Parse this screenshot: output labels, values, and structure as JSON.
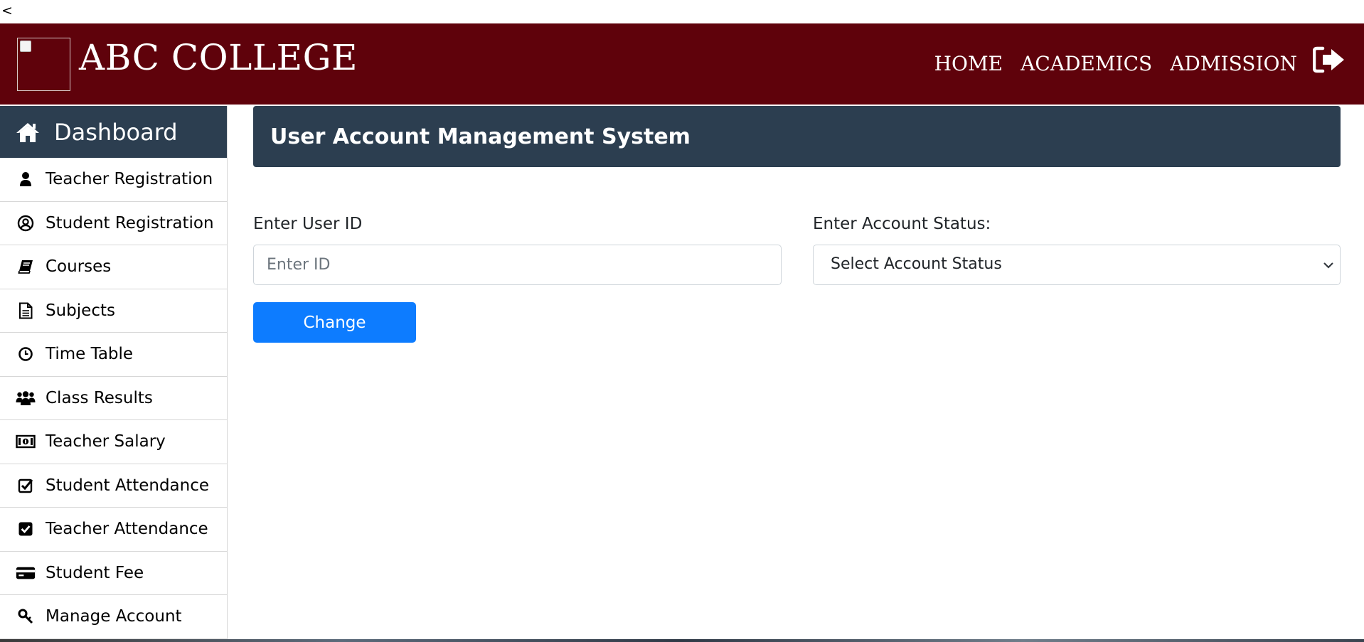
{
  "back_link": "<",
  "header": {
    "brand": "ABC COLLEGE",
    "nav": [
      "HOME",
      "ACADEMICS",
      "ADMISSION"
    ],
    "logout_icon": "sign-out-icon",
    "bg_color": "#5f020b"
  },
  "sidebar": {
    "header": {
      "label": "Dashboard",
      "icon": "home-icon"
    },
    "items": [
      {
        "label": "Teacher Registration",
        "icon": "user-icon"
      },
      {
        "label": "Student Registration",
        "icon": "user-circle-icon"
      },
      {
        "label": "Courses",
        "icon": "book-icon"
      },
      {
        "label": "Subjects",
        "icon": "file-text-icon"
      },
      {
        "label": "Time Table",
        "icon": "clock-icon"
      },
      {
        "label": "Class Results",
        "icon": "users-icon"
      },
      {
        "label": "Teacher Salary",
        "icon": "money-icon"
      },
      {
        "label": "Student Attendance",
        "icon": "check-square-outline-icon"
      },
      {
        "label": "Teacher Attendance",
        "icon": "check-square-icon"
      },
      {
        "label": "Student Fee",
        "icon": "credit-card-icon"
      },
      {
        "label": "Manage Account",
        "icon": "key-icon"
      }
    ],
    "header_color": "#2c3e50"
  },
  "main": {
    "title": "User Account Management System",
    "user_id_label": "Enter User ID",
    "user_id_placeholder": "Enter ID",
    "status_label": "Enter Account Status:",
    "status_value": "Select Account Status",
    "change_button": "Change",
    "button_color": "#0d7cff"
  }
}
